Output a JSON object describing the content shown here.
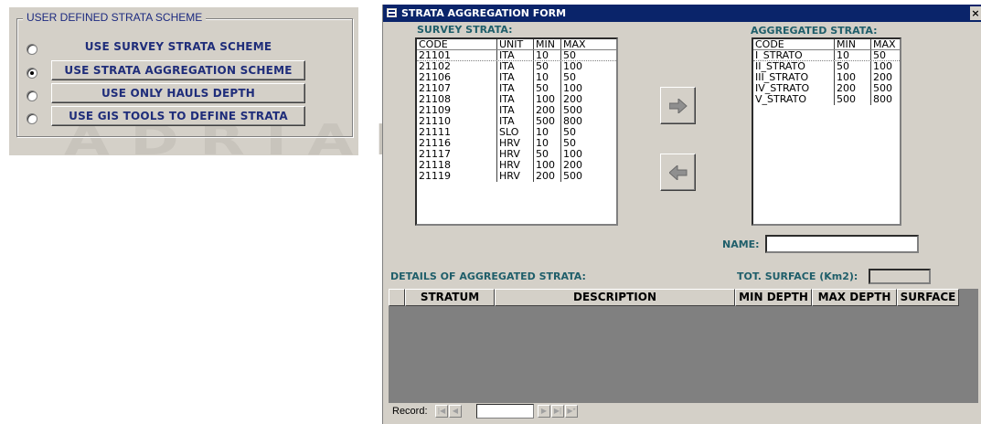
{
  "scheme_panel": {
    "legend": "USER DEFINED STRATA SCHEME",
    "watermark": "ADRIAMED",
    "options": [
      {
        "label": "USE SURVEY STRATA SCHEME",
        "checked": false
      },
      {
        "label": "USE STRATA AGGREGATION SCHEME",
        "checked": true
      },
      {
        "label": "USE ONLY HAULS DEPTH",
        "checked": false
      },
      {
        "label": "USE GIS TOOLS TO DEFINE STRATA",
        "checked": false
      }
    ]
  },
  "form": {
    "title": "STRATA AGGREGATION FORM",
    "close_glyph": "×",
    "survey_strata": {
      "label": "SURVEY STRATA:",
      "columns": [
        "CODE",
        "UNIT",
        "MIN",
        "MAX"
      ],
      "rows": [
        [
          "21101",
          "ITA",
          "10",
          "50"
        ],
        [
          "21102",
          "ITA",
          "50",
          "100"
        ],
        [
          "21106",
          "ITA",
          "10",
          "50"
        ],
        [
          "21107",
          "ITA",
          "50",
          "100"
        ],
        [
          "21108",
          "ITA",
          "100",
          "200"
        ],
        [
          "21109",
          "ITA",
          "200",
          "500"
        ],
        [
          "21110",
          "ITA",
          "500",
          "800"
        ],
        [
          "21111",
          "SLO",
          "10",
          "50"
        ],
        [
          "21116",
          "HRV",
          "10",
          "50"
        ],
        [
          "21117",
          "HRV",
          "50",
          "100"
        ],
        [
          "21118",
          "HRV",
          "100",
          "200"
        ],
        [
          "21119",
          "HRV",
          "200",
          "500"
        ]
      ]
    },
    "aggregated_strata": {
      "label": "AGGREGATED STRATA:",
      "columns": [
        "CODE",
        "MIN",
        "MAX"
      ],
      "rows": [
        [
          "I_STRATO",
          "10",
          "50"
        ],
        [
          "II_STRATO",
          "50",
          "100"
        ],
        [
          "III_STRATO",
          "100",
          "200"
        ],
        [
          "IV_STRATO",
          "200",
          "500"
        ],
        [
          "V_STRATO",
          "500",
          "800"
        ]
      ]
    },
    "add_icon": "arrow-right-icon",
    "remove_icon": "arrow-left-icon",
    "name_label": "NAME:",
    "name_value": "",
    "details_label": "DETAILS OF AGGREGATED STRATA:",
    "tot_surface_label": "TOT. SURFACE (Km2):",
    "tot_surface_value": "",
    "grid_columns": [
      "STRATUM",
      "DESCRIPTION",
      "MIN DEPTH",
      "MAX DEPTH",
      "SURFACE"
    ],
    "record_label": "Record:",
    "record_value": "",
    "nav_glyphs": {
      "first": "|◀",
      "prev": "◀",
      "next": "▶",
      "last": "▶|",
      "new": "▶*"
    }
  },
  "colors": {
    "label_teal": "#1f5e6a",
    "button_text": "#1f2d7a",
    "titlebar": "#0a246a",
    "window_gray": "#d4d0c8"
  }
}
